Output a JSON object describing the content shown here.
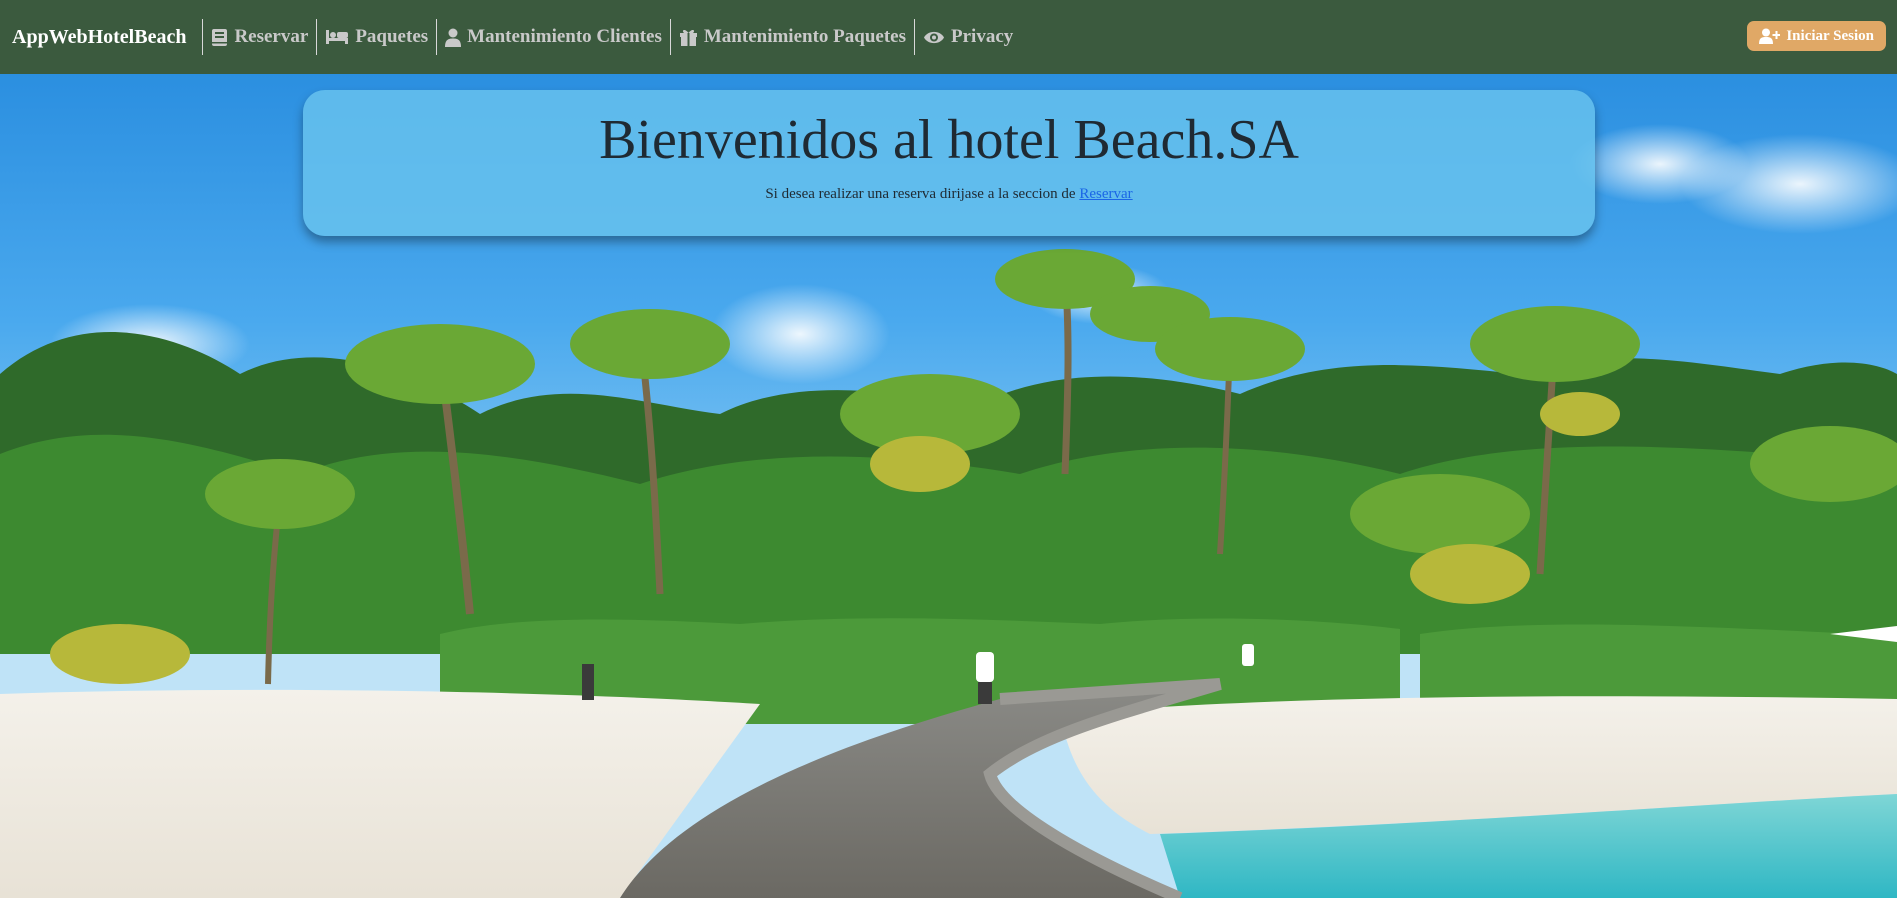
{
  "nav": {
    "brand": "AppWebHotelBeach",
    "items": [
      {
        "label": "Reservar",
        "icon": "book-icon"
      },
      {
        "label": "Paquetes",
        "icon": "bed-icon"
      },
      {
        "label": "Mantenimiento Clientes",
        "icon": "user-icon"
      },
      {
        "label": "Mantenimiento Paquetes",
        "icon": "gift-icon"
      },
      {
        "label": "Privacy",
        "icon": "eye-icon"
      }
    ],
    "login_label": "Iniciar Sesion",
    "login_icon": "user-plus-icon"
  },
  "hero": {
    "title": "Bienvenidos al hotel Beach.SA",
    "subtitle_text": "Si desea realizar una reserva dirijase a la seccion de",
    "subtitle_link": "Reservar"
  },
  "colors": {
    "navbar_bg": "#3b5a3e",
    "login_button_bg": "#e0a866",
    "link": "#1a66e6",
    "welcome_panel_bg": "#69c3ee"
  }
}
